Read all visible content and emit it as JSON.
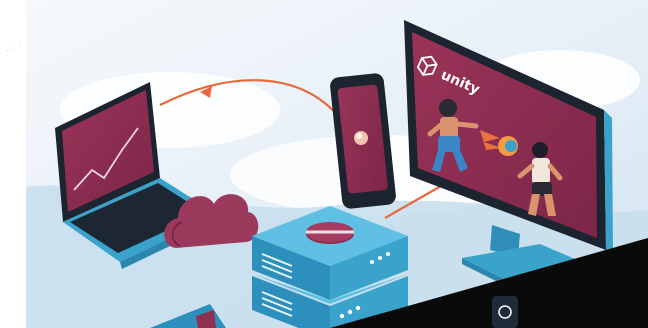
{
  "illustration": {
    "monitor_brand": "unity",
    "colors": {
      "background": "#eef3f8",
      "sky_blue": "#cfe6f4",
      "maroon": "#8f2f52",
      "cyan": "#40a9cf",
      "dark_navy": "#1c2430",
      "orange_link": "#e9683b",
      "black_band": "#0a0a0a"
    },
    "icons": [
      "laptop-icon",
      "phone-icon",
      "monitor-icon",
      "cloud-icon",
      "server-icon",
      "fighter-character",
      "fireball"
    ]
  }
}
